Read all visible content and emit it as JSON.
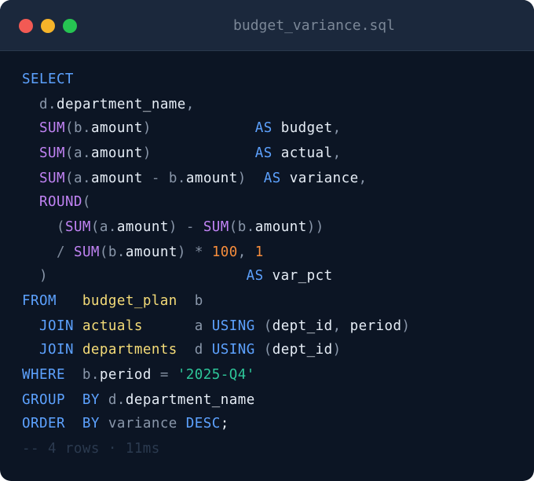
{
  "window": {
    "title": "budget_variance.sql",
    "buttons": {
      "close_color": "#f25a54",
      "minimize_color": "#f5b42a",
      "maximize_color": "#26c452"
    }
  },
  "colors": {
    "background": "#0c1524",
    "titlebar": "#1b283c",
    "keyword": "#5da2ff",
    "function": "#c183f4",
    "table": "#f5dc78",
    "string": "#2ec79a",
    "number": "#f78d3c",
    "alias": "#8a97aa",
    "identifier": "#e6edf6",
    "comment": "#2b3a4f"
  },
  "code": {
    "lines": [
      [
        {
          "t": "SELECT",
          "c": "kw"
        }
      ],
      [
        {
          "t": "  "
        },
        {
          "t": "d",
          "c": "al"
        },
        {
          "t": ".",
          "c": "pun"
        },
        {
          "t": "department_name",
          "c": "col"
        },
        {
          "t": ",",
          "c": "pun"
        }
      ],
      [
        {
          "t": "  "
        },
        {
          "t": "SUM",
          "c": "fn"
        },
        {
          "t": "(",
          "c": "pun"
        },
        {
          "t": "b",
          "c": "al"
        },
        {
          "t": ".",
          "c": "pun"
        },
        {
          "t": "amount",
          "c": "col"
        },
        {
          "t": ")",
          "c": "pun"
        },
        {
          "t": "            "
        },
        {
          "t": "AS",
          "c": "kw"
        },
        {
          "t": " "
        },
        {
          "t": "budget",
          "c": "col"
        },
        {
          "t": ",",
          "c": "pun"
        }
      ],
      [
        {
          "t": "  "
        },
        {
          "t": "SUM",
          "c": "fn"
        },
        {
          "t": "(",
          "c": "pun"
        },
        {
          "t": "a",
          "c": "al"
        },
        {
          "t": ".",
          "c": "pun"
        },
        {
          "t": "amount",
          "c": "col"
        },
        {
          "t": ")",
          "c": "pun"
        },
        {
          "t": "            "
        },
        {
          "t": "AS",
          "c": "kw"
        },
        {
          "t": " "
        },
        {
          "t": "actual",
          "c": "col"
        },
        {
          "t": ",",
          "c": "pun"
        }
      ],
      [
        {
          "t": "  "
        },
        {
          "t": "SUM",
          "c": "fn"
        },
        {
          "t": "(",
          "c": "pun"
        },
        {
          "t": "a",
          "c": "al"
        },
        {
          "t": ".",
          "c": "pun"
        },
        {
          "t": "amount",
          "c": "col"
        },
        {
          "t": " - ",
          "c": "op"
        },
        {
          "t": "b",
          "c": "al"
        },
        {
          "t": ".",
          "c": "pun"
        },
        {
          "t": "amount",
          "c": "col"
        },
        {
          "t": ")",
          "c": "pun"
        },
        {
          "t": "  "
        },
        {
          "t": "AS",
          "c": "kw"
        },
        {
          "t": " "
        },
        {
          "t": "variance",
          "c": "col"
        },
        {
          "t": ",",
          "c": "pun"
        }
      ],
      [
        {
          "t": "  "
        },
        {
          "t": "ROUND",
          "c": "fn"
        },
        {
          "t": "(",
          "c": "pun"
        }
      ],
      [
        {
          "t": "    "
        },
        {
          "t": "(",
          "c": "pun"
        },
        {
          "t": "SUM",
          "c": "fn"
        },
        {
          "t": "(",
          "c": "pun"
        },
        {
          "t": "a",
          "c": "al"
        },
        {
          "t": ".",
          "c": "pun"
        },
        {
          "t": "amount",
          "c": "col"
        },
        {
          "t": ")",
          "c": "pun"
        },
        {
          "t": " - ",
          "c": "op"
        },
        {
          "t": "SUM",
          "c": "fn"
        },
        {
          "t": "(",
          "c": "pun"
        },
        {
          "t": "b",
          "c": "al"
        },
        {
          "t": ".",
          "c": "pun"
        },
        {
          "t": "amount",
          "c": "col"
        },
        {
          "t": "))",
          "c": "pun"
        }
      ],
      [
        {
          "t": "    "
        },
        {
          "t": "/",
          "c": "op"
        },
        {
          "t": " "
        },
        {
          "t": "SUM",
          "c": "fn"
        },
        {
          "t": "(",
          "c": "pun"
        },
        {
          "t": "b",
          "c": "al"
        },
        {
          "t": ".",
          "c": "pun"
        },
        {
          "t": "amount",
          "c": "col"
        },
        {
          "t": ")",
          "c": "pun"
        },
        {
          "t": " * ",
          "c": "op"
        },
        {
          "t": "100",
          "c": "num"
        },
        {
          "t": ", ",
          "c": "pun"
        },
        {
          "t": "1",
          "c": "num"
        }
      ],
      [
        {
          "t": "  "
        },
        {
          "t": ")",
          "c": "pun"
        },
        {
          "t": "                       "
        },
        {
          "t": "AS",
          "c": "kw"
        },
        {
          "t": " "
        },
        {
          "t": "var_pct",
          "c": "col"
        }
      ],
      [
        {
          "t": "FROM",
          "c": "kw"
        },
        {
          "t": "   "
        },
        {
          "t": "budget_plan",
          "c": "tbl"
        },
        {
          "t": "  "
        },
        {
          "t": "b",
          "c": "al"
        }
      ],
      [
        {
          "t": "  "
        },
        {
          "t": "JOIN",
          "c": "kw"
        },
        {
          "t": " "
        },
        {
          "t": "actuals",
          "c": "tbl"
        },
        {
          "t": "      "
        },
        {
          "t": "a",
          "c": "al"
        },
        {
          "t": " "
        },
        {
          "t": "USING",
          "c": "kw"
        },
        {
          "t": " "
        },
        {
          "t": "(",
          "c": "pun"
        },
        {
          "t": "dept_id",
          "c": "col"
        },
        {
          "t": ", ",
          "c": "pun"
        },
        {
          "t": "period",
          "c": "col"
        },
        {
          "t": ")",
          "c": "pun"
        }
      ],
      [
        {
          "t": "  "
        },
        {
          "t": "JOIN",
          "c": "kw"
        },
        {
          "t": " "
        },
        {
          "t": "departments",
          "c": "tbl"
        },
        {
          "t": "  "
        },
        {
          "t": "d",
          "c": "al"
        },
        {
          "t": " "
        },
        {
          "t": "USING",
          "c": "kw"
        },
        {
          "t": " "
        },
        {
          "t": "(",
          "c": "pun"
        },
        {
          "t": "dept_id",
          "c": "col"
        },
        {
          "t": ")",
          "c": "pun"
        }
      ],
      [
        {
          "t": "WHERE",
          "c": "kw"
        },
        {
          "t": "  "
        },
        {
          "t": "b",
          "c": "al"
        },
        {
          "t": ".",
          "c": "pun"
        },
        {
          "t": "period",
          "c": "col"
        },
        {
          "t": " = ",
          "c": "op"
        },
        {
          "t": "'2025-Q4'",
          "c": "str"
        }
      ],
      [
        {
          "t": "GROUP",
          "c": "kw"
        },
        {
          "t": "  "
        },
        {
          "t": "BY",
          "c": "kw"
        },
        {
          "t": " "
        },
        {
          "t": "d",
          "c": "al"
        },
        {
          "t": ".",
          "c": "pun"
        },
        {
          "t": "department_name",
          "c": "col"
        }
      ],
      [
        {
          "t": "ORDER",
          "c": "kw"
        },
        {
          "t": "  "
        },
        {
          "t": "BY",
          "c": "kw"
        },
        {
          "t": " "
        },
        {
          "t": "variance",
          "c": "al"
        },
        {
          "t": " "
        },
        {
          "t": "DESC",
          "c": "kw"
        },
        {
          "t": ";",
          "c": "col"
        }
      ],
      [
        {
          "t": "-- 4 rows · 11ms",
          "c": "cm"
        }
      ]
    ]
  }
}
